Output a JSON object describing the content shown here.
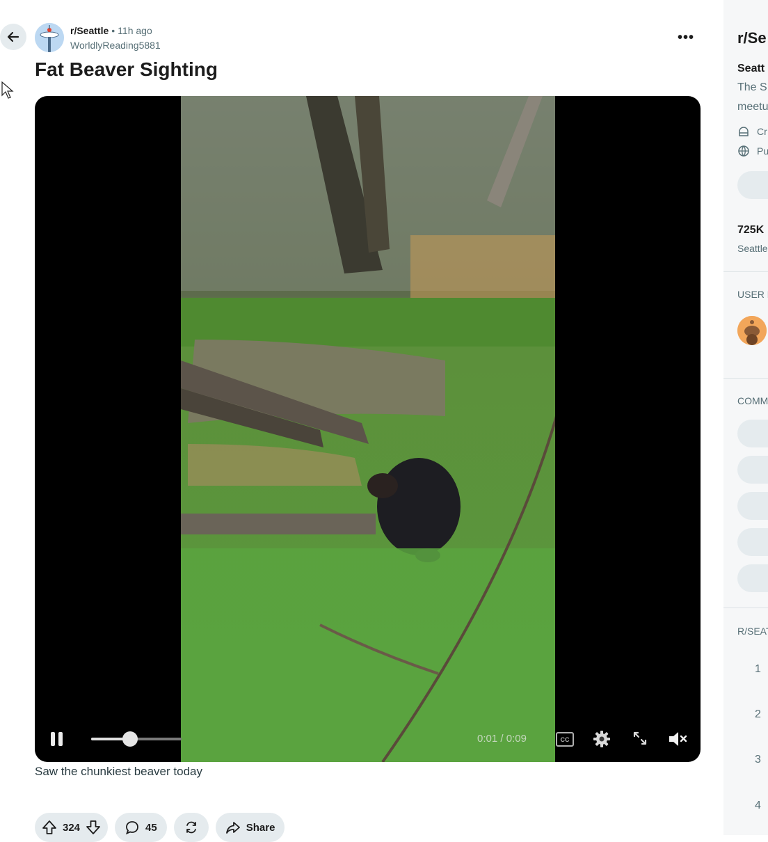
{
  "post": {
    "subreddit": "r/Seattle",
    "separator": "•",
    "time_ago": "11h ago",
    "author": "WorldlyReading5881",
    "title": "Fat Beaver Sighting",
    "caption": "Saw the chunkiest beaver today",
    "more_label": "•••"
  },
  "video": {
    "current_time": "0:01",
    "duration": "0:09",
    "time_separator": "/",
    "cc_label": "CC",
    "progress": 0.11
  },
  "actions": {
    "upvotes": "324",
    "comments": "45",
    "share_label": "Share"
  },
  "sidebar": {
    "title": "r/Se",
    "name": "Seatt",
    "desc_line1": "The S",
    "desc_line2": "meetu",
    "meta1_text": "Cr",
    "meta2_text": "Pu",
    "members_count": "725K",
    "members_label": "Seattle",
    "section_user": "USER F",
    "section_comm": "COMM",
    "section_rules": "R/SEAT",
    "ranks": [
      "1",
      "2",
      "3",
      "4"
    ]
  },
  "colors": {
    "pill_bg": "#e5ebee",
    "muted_text": "#576f76",
    "sidebar_bg": "#f6f7f8"
  }
}
